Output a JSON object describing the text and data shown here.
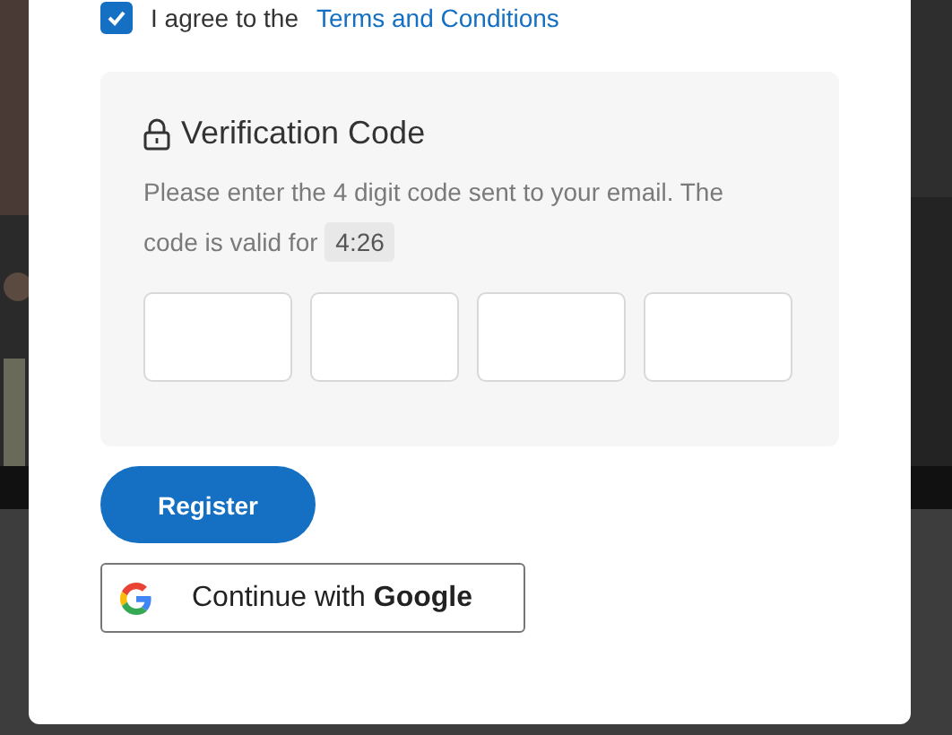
{
  "agreement": {
    "checked": true,
    "text": "I agree to the",
    "link": "Terms and Conditions"
  },
  "verification": {
    "title": "Verification Code",
    "message": "Please enter the 4 digit code sent to your email. The code is valid for",
    "timer": "4:26",
    "code_fields": [
      {
        "kind": "digit"
      },
      {
        "kind": "digit"
      },
      {
        "kind": "digit"
      },
      {
        "kind": "digit"
      }
    ]
  },
  "buttons": [
    {
      "kind": "primary",
      "label": "Register"
    },
    {
      "kind": "google",
      "label": "Continue with",
      "brand": "Google"
    }
  ]
}
